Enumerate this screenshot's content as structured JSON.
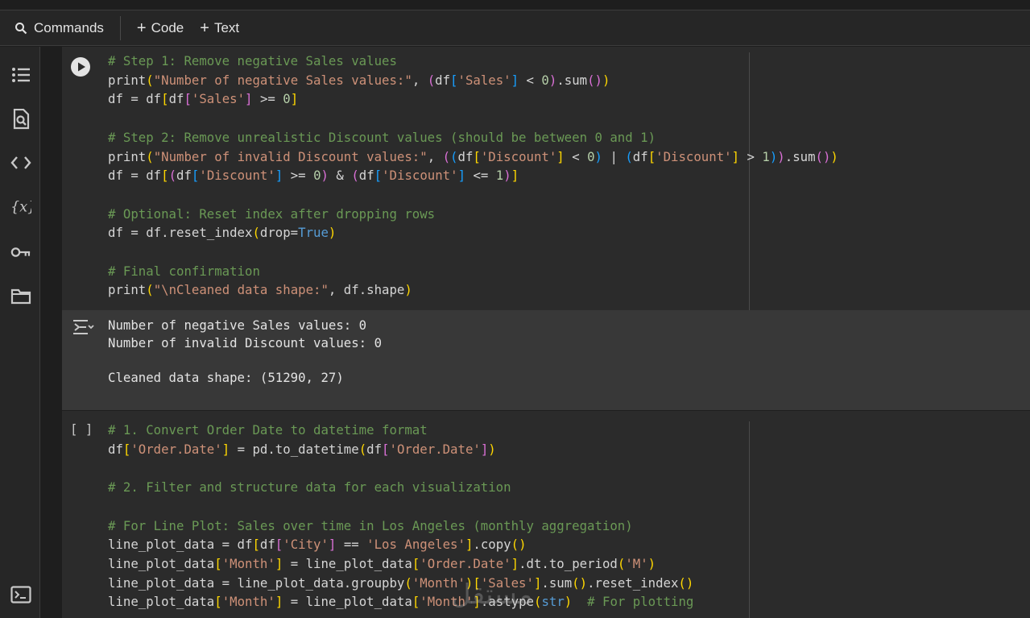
{
  "toolbar": {
    "commands_label": "Commands",
    "code_label": "Code",
    "text_label": "Text"
  },
  "sidebar": {
    "icons": [
      "table-of-contents-icon",
      "find-replace-icon",
      "code-snippets-icon",
      "variables-icon",
      "secrets-key-icon",
      "files-folder-icon",
      "terminal-icon"
    ]
  },
  "cell1": {
    "run_state": "play",
    "lines": [
      "# Step 1: Remove negative Sales values",
      "print(\"Number of negative Sales values:\", (df['Sales'] < 0).sum())",
      "df = df[df['Sales'] >= 0]",
      "",
      "# Step 2: Remove unrealistic Discount values (should be between 0 and 1)",
      "print(\"Number of invalid Discount values:\", ((df['Discount'] < 0) | (df['Discount'] > 1)).sum())",
      "df = df[(df['Discount'] >= 0) & (df['Discount'] <= 1)]",
      "",
      "# Optional: Reset index after dropping rows",
      "df = df.reset_index(drop=True)",
      "",
      "# Final confirmation",
      "print(\"\\nCleaned data shape:\", df.shape)"
    ]
  },
  "output1": {
    "lines": [
      "Number of negative Sales values: 0",
      "Number of invalid Discount values: 0",
      "",
      "Cleaned data shape: (51290, 27)"
    ]
  },
  "cell2": {
    "bracket": "[ ]",
    "lines": [
      "# 1. Convert Order Date to datetime format",
      "df['Order.Date'] = pd.to_datetime(df['Order.Date'])",
      "",
      "# 2. Filter and structure data for each visualization",
      "",
      "# For Line Plot: Sales over time in Los Angeles (monthly aggregation)",
      "line_plot_data = df[df['City'] == 'Los Angeles'].copy()",
      "line_plot_data['Month'] = line_plot_data['Order.Date'].dt.to_period('M')",
      "line_plot_data = line_plot_data.groupby('Month')['Sales'].sum().reset_index()",
      "line_plot_data['Month'] = line_plot_data['Month'].astype(str)  # For plotting"
    ]
  },
  "colors": {
    "comment": "#6a9955",
    "string": "#ce9178",
    "keyword": "#569cd6",
    "bracket1": "#ffd700",
    "bracket2": "#da70d6",
    "bracket3": "#179fff"
  },
  "watermark": "مستقل"
}
